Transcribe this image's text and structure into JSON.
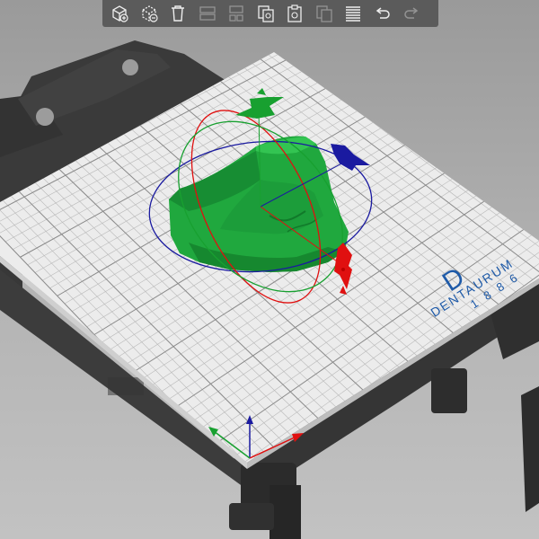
{
  "toolbar": {
    "buttons": [
      {
        "icon": "add-object-icon",
        "enabled": true
      },
      {
        "icon": "remove-object-icon",
        "enabled": true
      },
      {
        "icon": "delete-all-icon",
        "enabled": true
      },
      {
        "icon": "arrange-icon",
        "enabled": false
      },
      {
        "icon": "split-icon",
        "enabled": false
      },
      {
        "icon": "copy-icon",
        "enabled": true
      },
      {
        "icon": "paste-icon",
        "enabled": true
      },
      {
        "icon": "instance-icon",
        "enabled": false
      },
      {
        "icon": "layers-icon",
        "enabled": true
      },
      {
        "icon": "undo-icon",
        "enabled": true
      },
      {
        "icon": "redo-icon",
        "enabled": false
      }
    ]
  },
  "bed": {
    "logo_letter": "D",
    "logo_name": "DENTAURUM",
    "logo_year": "1886",
    "logo_color": "#1e5aa8"
  },
  "model": {
    "color": "#1fa83c"
  },
  "gizmo": {
    "x_color": "#e01010",
    "y_color": "#18a030",
    "z_color": "#1a1aa0"
  }
}
